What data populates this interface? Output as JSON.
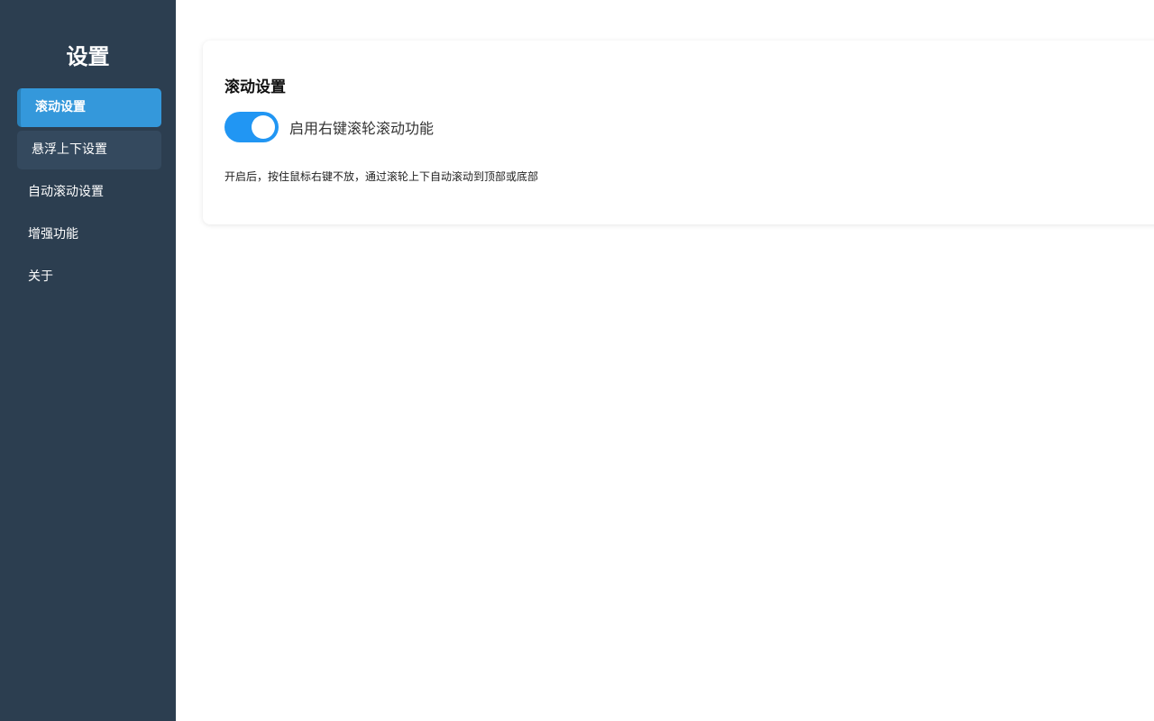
{
  "sidebar": {
    "title": "设置",
    "items": [
      {
        "label": "滚动设置"
      },
      {
        "label": "悬浮上下设置"
      },
      {
        "label": "自动滚动设置"
      },
      {
        "label": "增强功能"
      },
      {
        "label": "关于"
      }
    ]
  },
  "main": {
    "card": {
      "title": "滚动设置",
      "toggle_label": "启用右键滚轮滚动功能",
      "toggle_on": true,
      "description": "开启后，按住鼠标右键不放，通过滚轮上下自动滚动到顶部或底部"
    }
  },
  "colors": {
    "sidebar_bg": "#2c3e50",
    "active_item": "#3498db",
    "hover_item": "#34495e",
    "toggle_on": "#2196f3"
  }
}
